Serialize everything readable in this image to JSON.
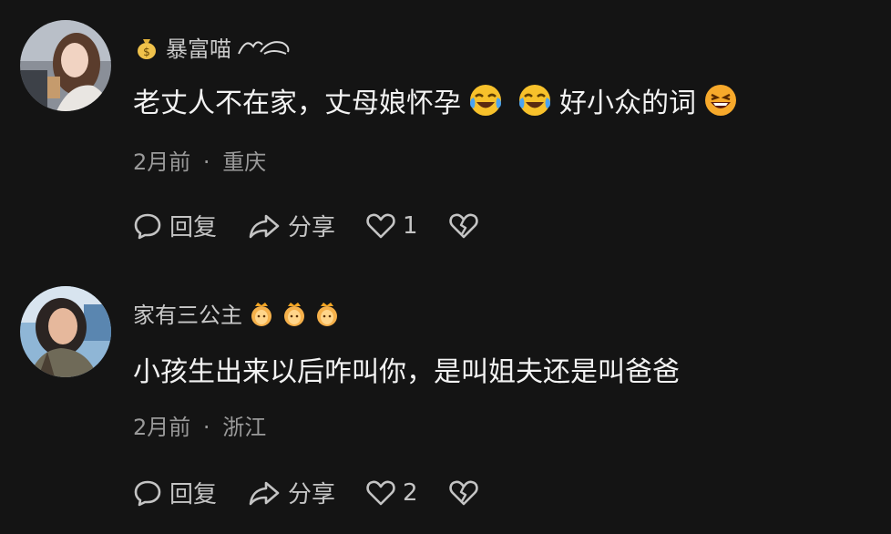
{
  "comments": [
    {
      "username": "暴富喵",
      "text_part1": "老丈人不在家，丈母娘怀孕",
      "text_part2": "好小众的词",
      "time": "2月前",
      "separator": "·",
      "location": "重庆",
      "reply_label": "回复",
      "share_label": "分享",
      "like_count": "1"
    },
    {
      "username": "家有三公主",
      "text": "小孩生出来以后咋叫你，是叫姐夫还是叫爸爸",
      "time": "2月前",
      "separator": "·",
      "location": "浙江",
      "reply_label": "回复",
      "share_label": "分享",
      "like_count": "2"
    }
  ],
  "colors": {
    "background": "#141414",
    "text": "#f2f2f2",
    "muted": "#9a9a9a",
    "emoji": "#f7c12b"
  },
  "icons": [
    "money-bag-icon",
    "laugh-cry-emoji",
    "grin-emoji",
    "princess-emoji",
    "reply-icon",
    "share-icon",
    "heart-icon",
    "broken-heart-icon"
  ]
}
